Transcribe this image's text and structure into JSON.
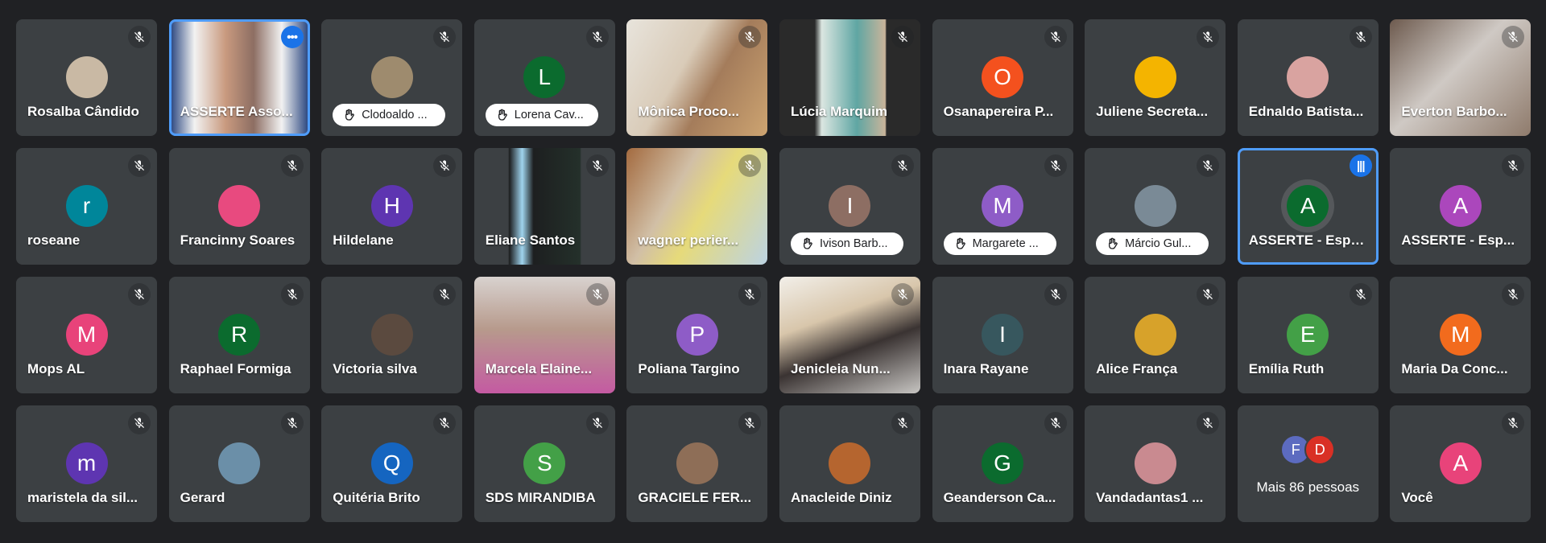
{
  "participants": [
    {
      "name": "Rosalba Cândido",
      "avatar": "",
      "color": "#c9b9a4",
      "type": "avatar",
      "photo": true
    },
    {
      "name": "ASSERTE Asso...",
      "type": "video",
      "bg": "linear-gradient(90deg,#1d3b78 0%,#f2f2f2 18%,#c99a7f 40%,#8d6e63 60%,#f2f2f2 80%,#1d3b78 100%)",
      "active": true,
      "badge": "•••"
    },
    {
      "name": "Clodoaldo ...",
      "avatar": "",
      "color": "#9e8b6e",
      "type": "pill",
      "photo": true
    },
    {
      "name": "Lorena Cav...",
      "avatar": "L",
      "color": "#0b6b2e",
      "type": "pill"
    },
    {
      "name": "Mônica Proco...",
      "type": "video",
      "bg": "linear-gradient(120deg,#e8e4dc 0%,#d9cbb8 40%,#a47c5b 60%,#cda471 100%)"
    },
    {
      "name": "Lúcia Marquim",
      "type": "video",
      "bg": "linear-gradient(90deg,#2a2a2a 0%,#2a2a2a 25%,#dbe6e1 30%,#5fa6a3 55%,#c9b49a 75%,#2a2a2a 76%)"
    },
    {
      "name": "Osanapereira P...",
      "avatar": "O",
      "color": "#f4511e",
      "type": "avatar"
    },
    {
      "name": "Juliene Secreta...",
      "avatar": "",
      "color": "#f4b400",
      "type": "avatar",
      "photo": true
    },
    {
      "name": "Ednaldo Batista...",
      "avatar": "",
      "color": "#d9a3a0",
      "type": "avatar",
      "photo": true
    },
    {
      "name": "Everton Barbo...",
      "type": "video",
      "bg": "linear-gradient(135deg,#6d5a4e 0%,#cfc9c4 45%,#8f7b6c 100%)"
    },
    {
      "name": "roseane",
      "avatar": "r",
      "color": "#00869a",
      "type": "avatar"
    },
    {
      "name": "Francinny Soares",
      "avatar": "",
      "color": "#e84a7f",
      "type": "avatar",
      "photo": true
    },
    {
      "name": "Hildelane",
      "avatar": "H",
      "color": "#5e35b1",
      "type": "avatar"
    },
    {
      "name": "Eliane Santos",
      "type": "video",
      "bg": "linear-gradient(90deg,#3c4043 0%,#3c4043 24%,#1d1f20 25%,#9fd4ee 34%,#1d1f20 42%,#24302a 75%,#3c4043 76%)"
    },
    {
      "name": "wagner perier...",
      "type": "video",
      "bg": "linear-gradient(120deg,#a36a3f 0%,#d1bfa6 35%,#e6da7a 55%,#bcd3e3 100%)"
    },
    {
      "name": "Ivison Barb...",
      "avatar": "I",
      "color": "#8d6e63",
      "type": "pill"
    },
    {
      "name": "Margarete ...",
      "avatar": "M",
      "color": "#8e5cc7",
      "type": "pill"
    },
    {
      "name": "Márcio Gul...",
      "avatar": "",
      "color": "#7a8a96",
      "type": "pill",
      "photo": true
    },
    {
      "name": "ASSERTE - Espe...",
      "avatar": "A",
      "color": "#0b6b2e",
      "type": "avatar",
      "active": true,
      "badge": "|||",
      "ring": true
    },
    {
      "name": "ASSERTE - Esp...",
      "avatar": "A",
      "color": "#ab47bc",
      "type": "avatar"
    },
    {
      "name": "Mops AL",
      "avatar": "M",
      "color": "#e8437a",
      "type": "avatar"
    },
    {
      "name": "Raphael Formiga",
      "avatar": "R",
      "color": "#0b6b2e",
      "type": "avatar"
    },
    {
      "name": "Victoria silva",
      "avatar": "",
      "color": "#5b4a3f",
      "type": "avatar",
      "photo": true
    },
    {
      "name": "Marcela Elaine...",
      "type": "video",
      "bg": "linear-gradient(180deg,#d8d2cf 0%,#b79a8c 45%,#c45aa2 100%)"
    },
    {
      "name": "Poliana Targino",
      "avatar": "P",
      "color": "#8e5cc7",
      "type": "avatar"
    },
    {
      "name": "Jenicleia Nun...",
      "type": "video",
      "bg": "linear-gradient(160deg,#f2efe9 0%,#d8c6ab 35%,#3a3332 60%,#c7c5c2 100%)"
    },
    {
      "name": "Inara Rayane",
      "avatar": "I",
      "color": "#37575e",
      "type": "avatar"
    },
    {
      "name": "Alice França",
      "avatar": "",
      "color": "#d7a22a",
      "type": "avatar",
      "photo": true
    },
    {
      "name": "Emília Ruth",
      "avatar": "E",
      "color": "#43a047",
      "type": "avatar"
    },
    {
      "name": "Maria Da Conc...",
      "avatar": "M",
      "color": "#f26b1d",
      "type": "avatar"
    },
    {
      "name": "maristela da sil...",
      "avatar": "m",
      "color": "#5e35b1",
      "type": "avatar"
    },
    {
      "name": "Gerard",
      "avatar": "",
      "color": "#6b8fa8",
      "type": "avatar",
      "photo": true
    },
    {
      "name": "Quitéria Brito",
      "avatar": "Q",
      "color": "#1565c0",
      "type": "avatar"
    },
    {
      "name": "SDS MIRANDIBA",
      "avatar": "S",
      "color": "#43a047",
      "type": "avatar"
    },
    {
      "name": "GRACIELE FER...",
      "avatar": "",
      "color": "#8e6e57",
      "type": "avatar",
      "photo": true
    },
    {
      "name": "Anacleide Diniz",
      "avatar": "",
      "color": "#b5652f",
      "type": "avatar",
      "photo": true
    },
    {
      "name": "Geanderson Ca...",
      "avatar": "G",
      "color": "#0b6b2e",
      "type": "avatar"
    },
    {
      "name": "Vandadantas1 ...",
      "avatar": "",
      "color": "#c98a90",
      "type": "avatar",
      "photo": true
    },
    {
      "name": "Mais 86 pessoas",
      "type": "more",
      "avatars": [
        {
          "letter": "F",
          "color": "#5c6bc0"
        },
        {
          "letter": "D",
          "color": "#d93025"
        }
      ]
    },
    {
      "name": "Você",
      "avatar": "A",
      "color": "#e8437a",
      "type": "avatar"
    }
  ]
}
